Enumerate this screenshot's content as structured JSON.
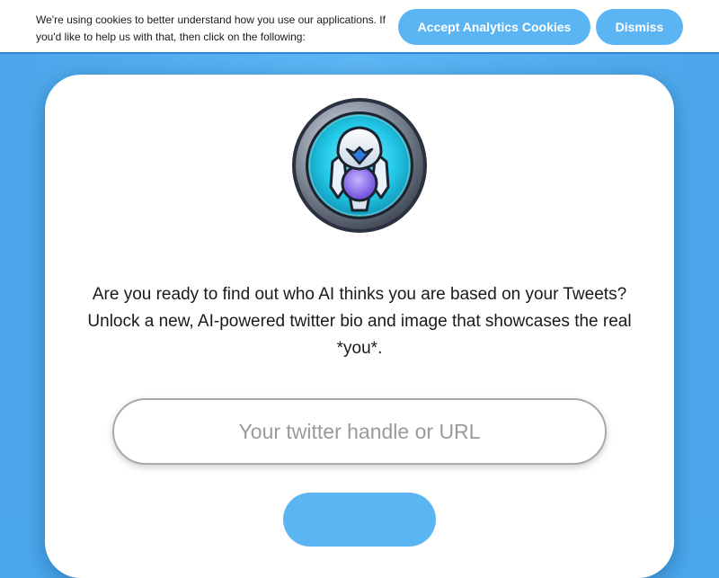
{
  "cookie_banner": {
    "message": "We're using cookies to better understand how you use our applications. If you'd like to help us with that, then click on the following:",
    "accept_label": "Accept Analytics Cookies",
    "dismiss_label": "Dismiss"
  },
  "main": {
    "logo_icon": "robot-avatar-badge-icon",
    "intro_text": "Are you ready to find out who AI thinks you are based on your Tweets? Unlock a new, AI-powered twitter bio and image that showcases the real *you*.",
    "handle_input": {
      "placeholder": "Your twitter handle or URL",
      "value": ""
    },
    "submit_label": ""
  },
  "colors": {
    "page_background": "#4aa8ec",
    "button_accent": "#5bb5f3",
    "card_background": "#ffffff"
  }
}
